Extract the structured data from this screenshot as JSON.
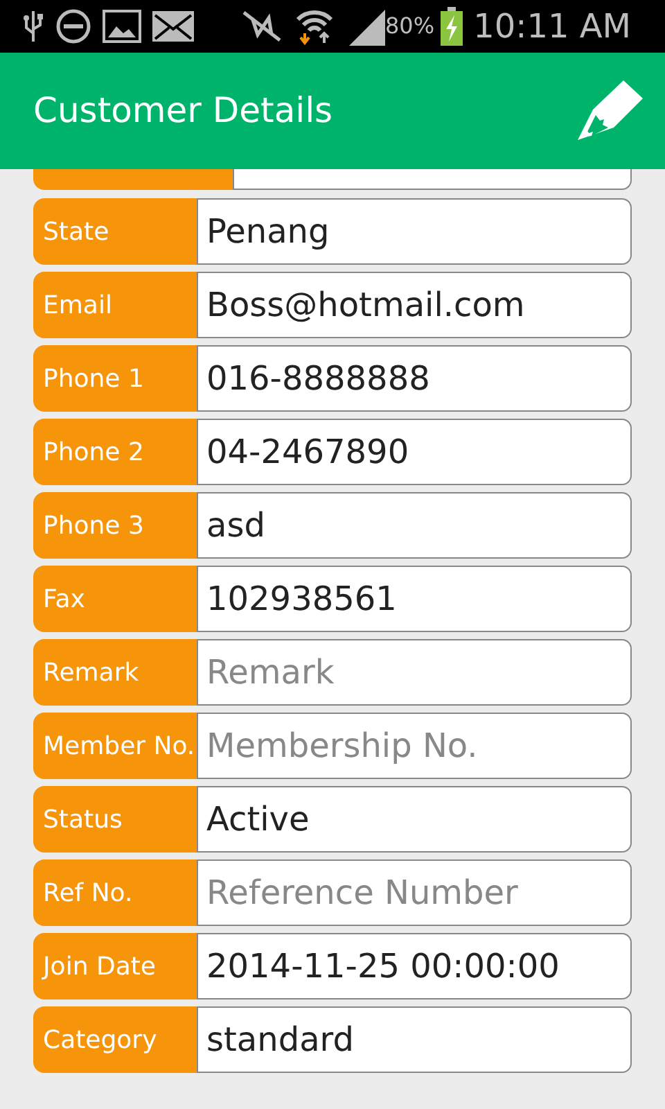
{
  "status_bar": {
    "battery": "80%",
    "time": "10:11 AM"
  },
  "app_bar": {
    "title": "Customer Details"
  },
  "fields": [
    {
      "label": "State",
      "value": "Penang"
    },
    {
      "label": "Email",
      "value": "Boss@hotmail.com"
    },
    {
      "label": "Phone 1",
      "value": "016-8888888"
    },
    {
      "label": "Phone 2",
      "value": "04-2467890"
    },
    {
      "label": "Phone 3",
      "value": "asd"
    },
    {
      "label": "Fax",
      "value": "102938561"
    },
    {
      "label": "Remark",
      "placeholder": "Remark"
    },
    {
      "label": "Member No.",
      "placeholder": "Membership No."
    },
    {
      "label": "Status",
      "value": "Active"
    },
    {
      "label": "Ref No.",
      "placeholder": "Reference Number"
    },
    {
      "label": "Join Date",
      "value": "2014-11-25 00:00:00"
    },
    {
      "label": "Category",
      "value": "standard"
    }
  ]
}
